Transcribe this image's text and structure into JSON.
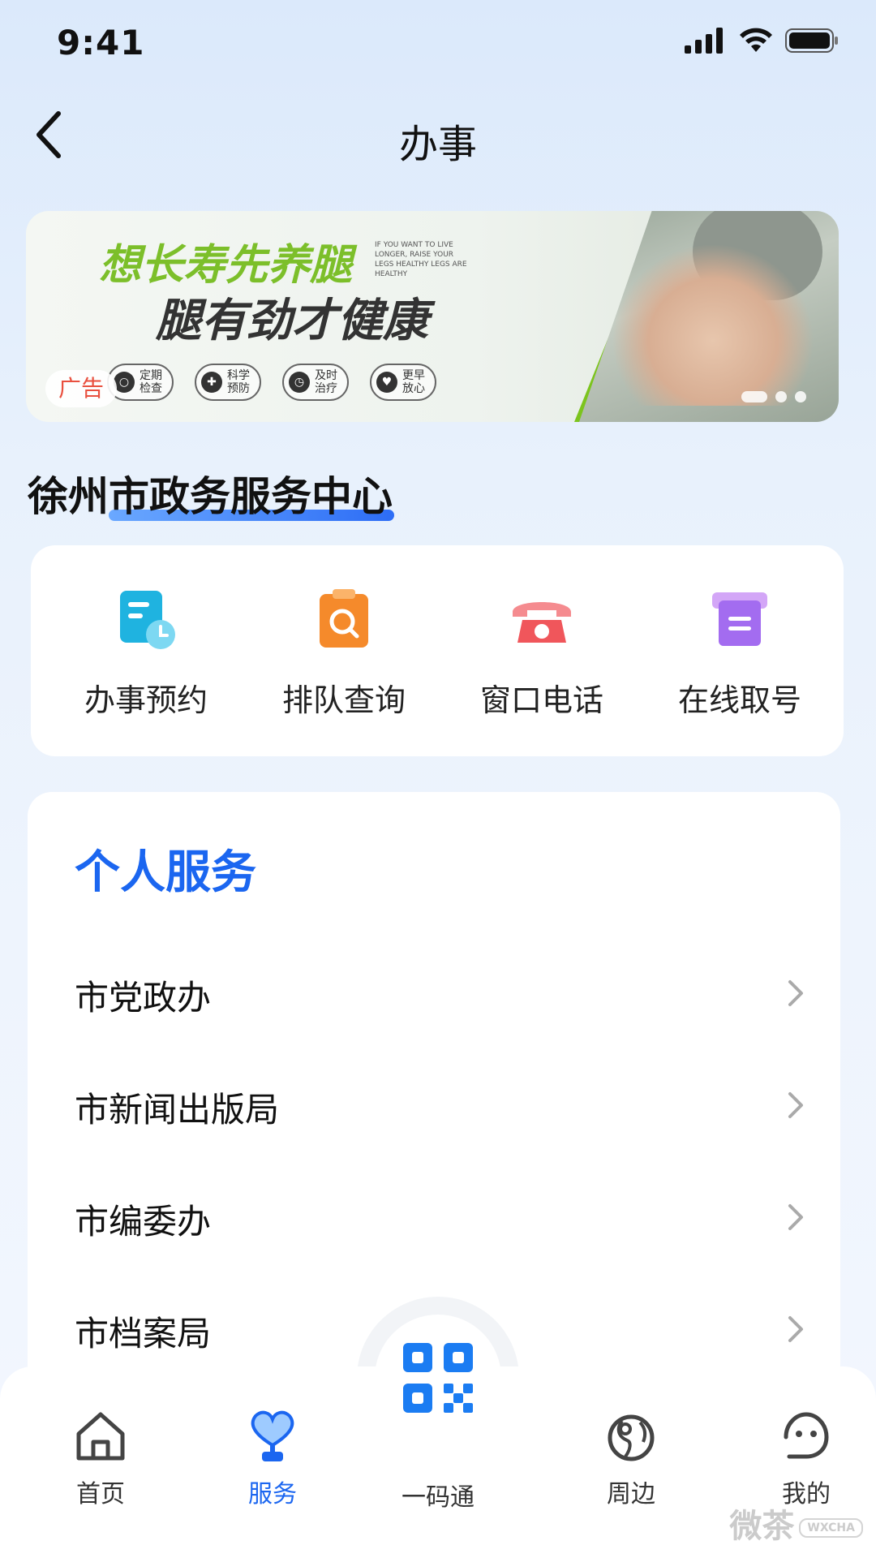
{
  "status_bar": {
    "time": "9:41"
  },
  "nav": {
    "title": "办事"
  },
  "banner": {
    "headline_1": "想长寿先养腿",
    "headline_2": "腿有劲才健康",
    "english_text": "IF YOU WANT TO LIVE LONGER, RAISE YOUR LEGS HEALTHY LEGS ARE HEALTHY",
    "ad_label": "广告",
    "pills": [
      "定期检查",
      "科学预防",
      "及时治疗",
      "更早放心"
    ],
    "slide_count": 3,
    "active_slide": 1
  },
  "center": {
    "heading": "徐州市政务服务中心"
  },
  "quick_actions": [
    {
      "label": "办事预约",
      "icon": "calendar-clock-icon",
      "color": "#1fb3e0"
    },
    {
      "label": "排队查询",
      "icon": "clipboard-search-icon",
      "color": "#f58a2b"
    },
    {
      "label": "窗口电话",
      "icon": "telephone-icon",
      "color": "#f0565b"
    },
    {
      "label": "在线取号",
      "icon": "ticket-dispenser-icon",
      "color": "#a36cf0"
    }
  ],
  "personal_services": {
    "title": "个人服务",
    "items": [
      "市党政办",
      "市新闻出版局",
      "市编委办",
      "市档案局"
    ]
  },
  "tabbar": {
    "items": [
      {
        "label": "首页",
        "icon": "home-icon"
      },
      {
        "label": "服务",
        "icon": "heart-hand-icon"
      },
      {
        "label": "一码通",
        "icon": "qr-code-icon"
      },
      {
        "label": "周边",
        "icon": "globe-pin-icon"
      },
      {
        "label": "我的",
        "icon": "user-face-icon"
      }
    ],
    "active": "服务"
  },
  "watermark": {
    "text": "微茶",
    "tag": "WXCHA"
  },
  "colors": {
    "accent": "#1b66f0",
    "ad_text": "#e9503f",
    "banner_green": "#7cc41d"
  }
}
